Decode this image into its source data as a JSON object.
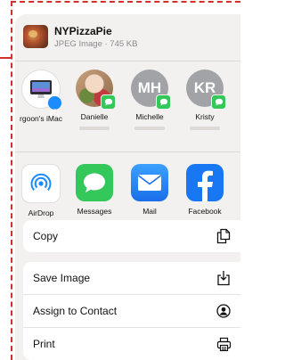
{
  "file": {
    "name": "NYPizzaPie",
    "meta": "JPEG Image · 745 KB"
  },
  "people": [
    {
      "name": "rgoon's iMac",
      "initials": "",
      "kind": "device"
    },
    {
      "name": "Danielle",
      "initials": "",
      "kind": "photo"
    },
    {
      "name": "Michelle",
      "initials": "MH",
      "kind": "initials"
    },
    {
      "name": "Kristy",
      "initials": "KR",
      "kind": "initials"
    }
  ],
  "apps": [
    {
      "label": "AirDrop",
      "icon": "airdrop-icon"
    },
    {
      "label": "Messages",
      "icon": "messages-icon"
    },
    {
      "label": "Mail",
      "icon": "mail-icon"
    },
    {
      "label": "Facebook",
      "icon": "facebook-icon"
    }
  ],
  "actions_group1": [
    {
      "label": "Copy",
      "icon": "copy-icon"
    }
  ],
  "actions_group2": [
    {
      "label": "Save Image",
      "icon": "save-icon"
    },
    {
      "label": "Assign to Contact",
      "icon": "contact-icon"
    },
    {
      "label": "Print",
      "icon": "print-icon"
    }
  ],
  "colors": {
    "annotation_dash": "#d0312d",
    "sheet_bg": "#f3f1ef",
    "messages_green": "#34c759",
    "mail_blue": "#1a8cff",
    "facebook_blue": "#1877f2",
    "avatar_gray": "#a1a3a6"
  }
}
